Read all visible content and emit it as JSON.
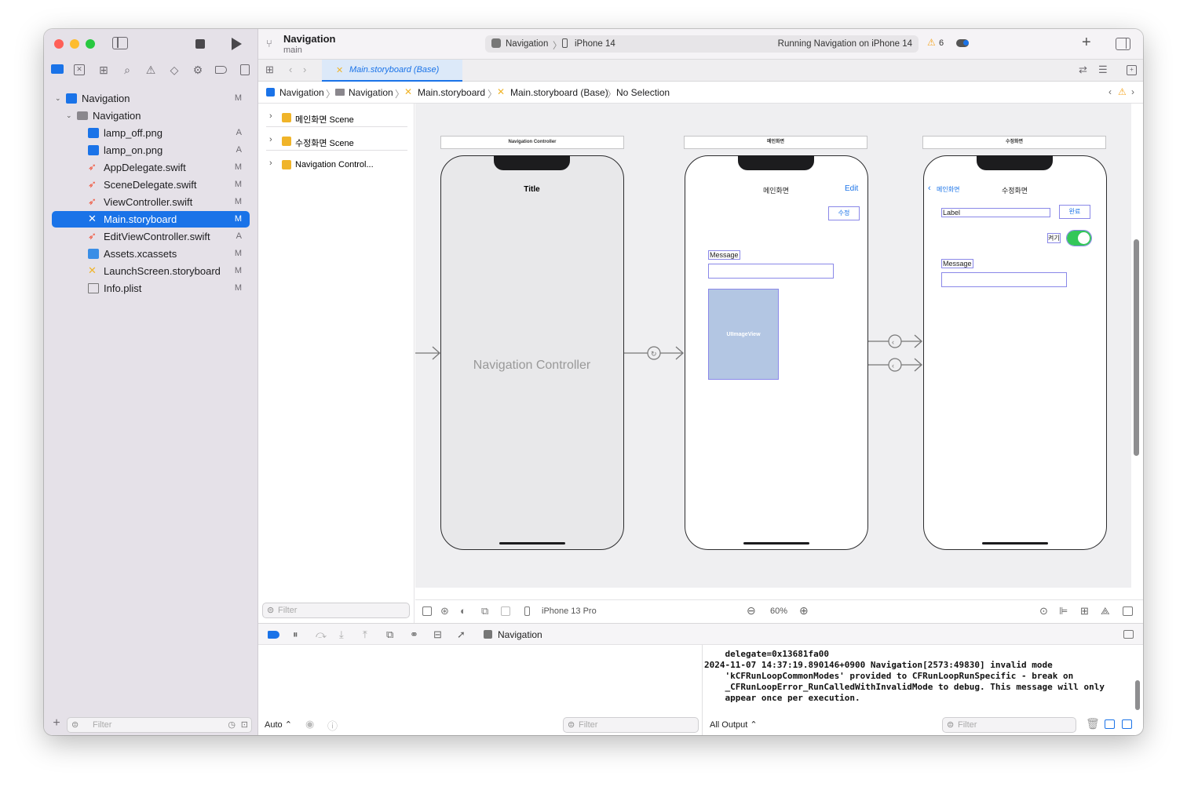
{
  "window": {
    "title": "Navigation",
    "branch": "main"
  },
  "toolbar": {
    "scheme": "Navigation",
    "device": "iPhone 14",
    "status": "Running Navigation on iPhone 14",
    "warning_count": "6"
  },
  "navigator": {
    "project": {
      "name": "Navigation",
      "status": "M"
    },
    "group": {
      "name": "Navigation"
    },
    "files": [
      {
        "name": "lamp_off.png",
        "status": "A",
        "icon": "image-file-icon"
      },
      {
        "name": "lamp_on.png",
        "status": "A",
        "icon": "image-file-icon"
      },
      {
        "name": "AppDelegate.swift",
        "status": "M",
        "icon": "swift-file-icon"
      },
      {
        "name": "SceneDelegate.swift",
        "status": "M",
        "icon": "swift-file-icon"
      },
      {
        "name": "ViewController.swift",
        "status": "M",
        "icon": "swift-file-icon"
      },
      {
        "name": "Main.storyboard",
        "status": "M",
        "icon": "storyboard-file-icon",
        "selected": true
      },
      {
        "name": "EditViewController.swift",
        "status": "A",
        "icon": "swift-file-icon"
      },
      {
        "name": "Assets.xcassets",
        "status": "M",
        "icon": "assets-file-icon"
      },
      {
        "name": "LaunchScreen.storyboard",
        "status": "M",
        "icon": "storyboard-file-icon"
      },
      {
        "name": "Info.plist",
        "status": "M",
        "icon": "plist-file-icon"
      }
    ],
    "filter_placeholder": "Filter"
  },
  "editor_tab": {
    "label": "Main.storyboard (Base)"
  },
  "jump_bar": [
    "Navigation",
    "Navigation",
    "Main.storyboard",
    "Main.storyboard (Base)",
    "No Selection"
  ],
  "outline": {
    "scenes": [
      "메인화면 Scene",
      "수정화면 Scene",
      "Navigation Control..."
    ],
    "filter_placeholder": "Filter"
  },
  "storyboard": {
    "nav_controller": {
      "header": "Navigation Controller",
      "title": "Title",
      "body": "Navigation Controller"
    },
    "main_scene": {
      "header": "메인화면",
      "title": "메인화면",
      "bar_button": "Edit",
      "edit_button": "수정",
      "message_label": "Message",
      "image_view": "UIImageView"
    },
    "edit_scene": {
      "header": "수정화면",
      "title": "수정화면",
      "back": "메인화면",
      "label": "Label",
      "done_button": "완료",
      "switch_label": "켜기",
      "message_label": "Message",
      "switch_on": true
    }
  },
  "canvas_bar": {
    "device": "iPhone 13 Pro",
    "zoom": "60%"
  },
  "debug_bar": {
    "target": "Navigation"
  },
  "console": {
    "lines": [
      "    delegate=0x13681fa00",
      "2024-11-07 14:37:19.890146+0900 Navigation[2573:49830] invalid mode",
      "    'kCFRunLoopCommonModes' provided to CFRunLoopRunSpecific - break on",
      "    _CFRunLoopError_RunCalledWithInvalidMode to debug. This message will only",
      "    appear once per execution."
    ],
    "left_mode": "Auto",
    "output_mode": "All Output",
    "filter_placeholder": "Filter"
  },
  "colors": {
    "accent": "#1a73e8",
    "warning": "#f5a623",
    "switch": "#34c759",
    "swift": "#f05138",
    "storyboard": "#f0b429"
  }
}
